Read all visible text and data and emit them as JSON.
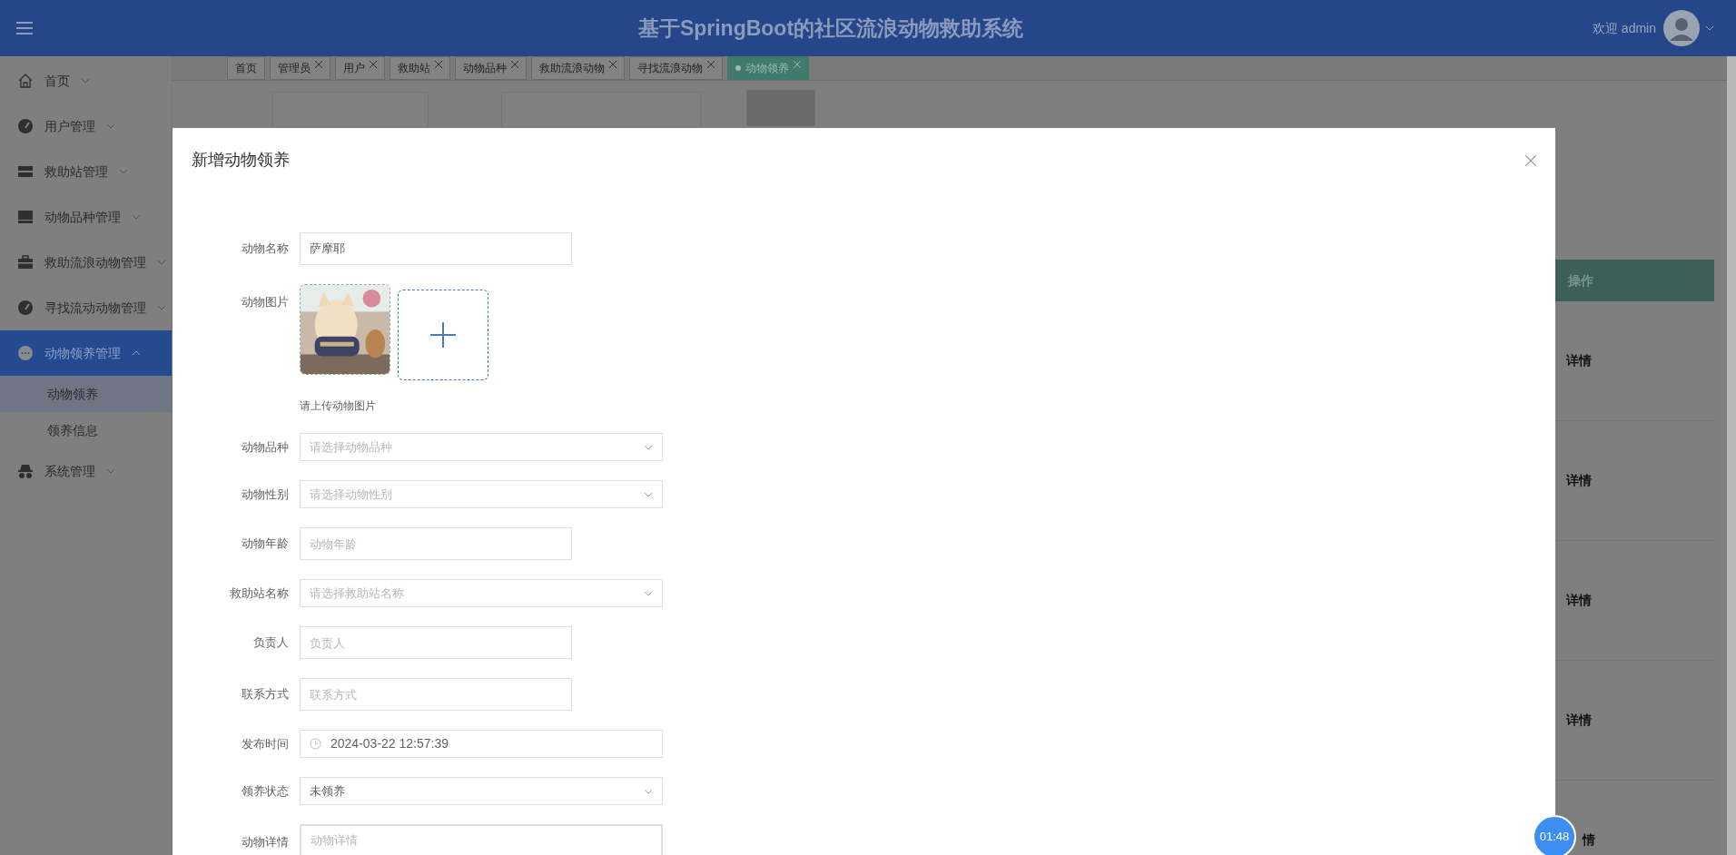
{
  "header": {
    "title": "基于SpringBoot的社区流浪动物救助系统",
    "welcome": "欢迎 admin"
  },
  "sidebar": {
    "items": [
      {
        "label": "首页",
        "selected": false,
        "expanded": false
      },
      {
        "label": "用户管理",
        "selected": false,
        "expanded": false
      },
      {
        "label": "救助站管理",
        "selected": false,
        "expanded": false
      },
      {
        "label": "动物品种管理",
        "selected": false,
        "expanded": false
      },
      {
        "label": "救助流浪动物管理",
        "selected": false,
        "expanded": false
      },
      {
        "label": "寻找流动动物管理",
        "selected": false,
        "expanded": false
      },
      {
        "label": "动物领养管理",
        "selected": true,
        "expanded": true,
        "children": [
          {
            "label": "动物领养",
            "selected": true
          },
          {
            "label": "领养信息",
            "selected": false
          }
        ]
      },
      {
        "label": "系统管理",
        "selected": false,
        "expanded": false
      }
    ]
  },
  "tabs": [
    {
      "label": "首页",
      "selected": false,
      "closable": false
    },
    {
      "label": "管理员",
      "selected": false,
      "closable": true
    },
    {
      "label": "用户",
      "selected": false,
      "closable": true
    },
    {
      "label": "救助站",
      "selected": false,
      "closable": true
    },
    {
      "label": "动物品种",
      "selected": false,
      "closable": true
    },
    {
      "label": "救助流浪动物",
      "selected": false,
      "closable": true
    },
    {
      "label": "寻找流浪动物",
      "selected": false,
      "closable": true
    },
    {
      "label": "动物领养",
      "selected": true,
      "closable": true
    }
  ],
  "modal": {
    "title": "新增动物领养",
    "fields": [
      {
        "kind": "input",
        "label": "动物名称",
        "value": "萨摩耶"
      },
      {
        "kind": "upload",
        "label": "动物图片",
        "hint": "请上传动物图片"
      },
      {
        "kind": "select",
        "label": "动物品种",
        "placeholder": "请选择动物品种"
      },
      {
        "kind": "select",
        "label": "动物性别",
        "placeholder": "请选择动物性别"
      },
      {
        "kind": "input",
        "label": "动物年龄",
        "placeholder": "动物年龄"
      },
      {
        "kind": "select",
        "label": "救助站名称",
        "placeholder": "请选择救助站名称"
      },
      {
        "kind": "input",
        "label": "负责人",
        "placeholder": "负责人"
      },
      {
        "kind": "input",
        "label": "联系方式",
        "placeholder": "联系方式"
      },
      {
        "kind": "date",
        "label": "发布时间",
        "value": "2024-03-22 12:57:39"
      },
      {
        "kind": "select",
        "label": "领养状态",
        "value": "未领养"
      },
      {
        "kind": "textarea",
        "label": "动物详情",
        "placeholder": "动物详情"
      }
    ]
  },
  "table": {
    "column": "操作",
    "rows": [
      {
        "action": "详情"
      },
      {
        "action": "详情"
      },
      {
        "action": "详情"
      },
      {
        "action": "详情"
      },
      {
        "action": "情"
      }
    ]
  },
  "timer": "01:48"
}
